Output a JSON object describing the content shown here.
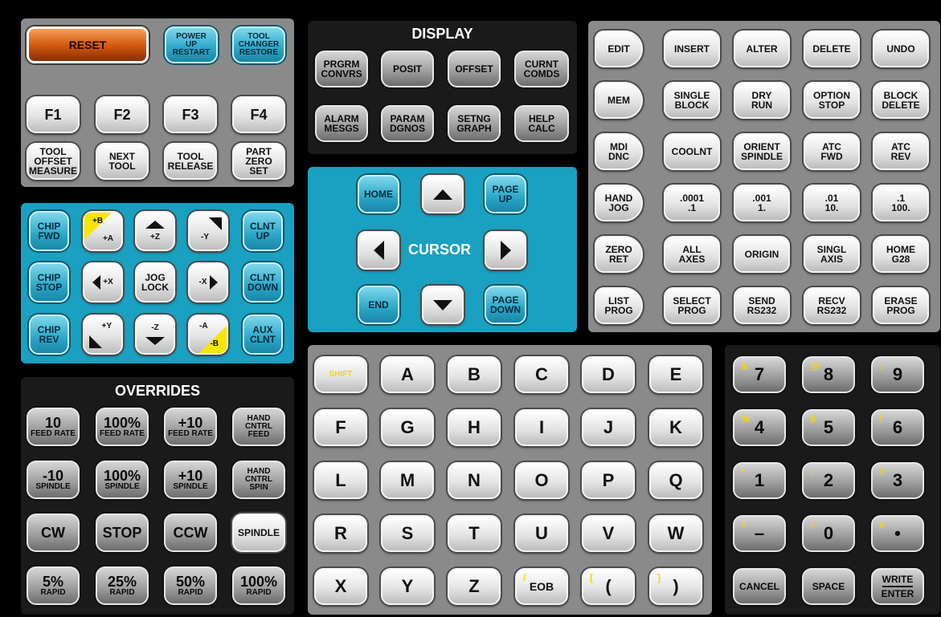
{
  "colors": {
    "grey_panel": "#8a8a8a",
    "dark_panel": "#1a1a1a",
    "teal_panel": "#1aa0c0",
    "reset": "#d45a10",
    "shift_text": "#f6d600"
  },
  "top_left": {
    "reset": "RESET",
    "power_up": [
      "POWER",
      "UP",
      "RESTART"
    ],
    "tool_changer": [
      "TOOL",
      "CHANGER",
      "RESTORE"
    ],
    "f_keys": [
      "F1",
      "F2",
      "F3",
      "F4"
    ],
    "tool_offset": [
      "TOOL",
      "OFFSET",
      "MEASURE"
    ],
    "next_tool": [
      "NEXT",
      "TOOL"
    ],
    "tool_release": [
      "TOOL",
      "RELEASE"
    ],
    "part_zero": [
      "PART",
      "ZERO",
      "SET"
    ]
  },
  "display": {
    "title": "DISPLAY",
    "keys": [
      [
        "PRGRM",
        "CONVRS"
      ],
      [
        "POSIT"
      ],
      [
        "OFFSET"
      ],
      [
        "CURNT",
        "COMDS"
      ],
      [
        "ALARM",
        "MESGS"
      ],
      [
        "PARAM",
        "DGNOS"
      ],
      [
        "SETNG",
        "GRAPH"
      ],
      [
        "HELP",
        "CALC"
      ]
    ]
  },
  "cursor": {
    "label": "CURSOR",
    "home": "HOME",
    "end": "END",
    "page_up": [
      "PAGE",
      "UP"
    ],
    "page_down": [
      "PAGE",
      "DOWN"
    ]
  },
  "modes": {
    "side": [
      [
        "EDIT"
      ],
      [
        "MEM"
      ],
      [
        "MDI",
        "DNC"
      ],
      [
        "HAND",
        "JOG"
      ],
      [
        "ZERO",
        "RET"
      ],
      [
        "LIST",
        "PROG"
      ]
    ],
    "rows": [
      [
        [
          "INSERT"
        ],
        [
          "ALTER"
        ],
        [
          "DELETE"
        ],
        [
          "UNDO"
        ]
      ],
      [
        [
          "SINGLE",
          "BLOCK"
        ],
        [
          "DRY",
          "RUN"
        ],
        [
          "OPTION",
          "STOP"
        ],
        [
          "BLOCK",
          "DELETE"
        ]
      ],
      [
        [
          "COOLNT"
        ],
        [
          "ORIENT",
          "SPINDLE"
        ],
        [
          "ATC",
          "FWD"
        ],
        [
          "ATC",
          "REV"
        ]
      ],
      [
        [
          ".0001",
          ".1"
        ],
        [
          ".001",
          "1."
        ],
        [
          ".01",
          "10."
        ],
        [
          ".1",
          "100."
        ]
      ],
      [
        [
          "ALL",
          "AXES"
        ],
        [
          "ORIGIN"
        ],
        [
          "SINGL",
          "AXIS"
        ],
        [
          "HOME",
          "G28"
        ]
      ],
      [
        [
          "SELECT",
          "PROG"
        ],
        [
          "SEND",
          "RS232"
        ],
        [
          "RECV",
          "RS232"
        ],
        [
          "ERASE",
          "PROG"
        ]
      ]
    ]
  },
  "jog": {
    "chip_fwd": [
      "CHIP",
      "FWD"
    ],
    "chip_stop": [
      "CHIP",
      "STOP"
    ],
    "chip_rev": [
      "CHIP",
      "REV"
    ],
    "clnt_up": [
      "CLNT",
      "UP"
    ],
    "clnt_down": [
      "CLNT",
      "DOWN"
    ],
    "aux_clnt": [
      "AUX",
      "CLNT"
    ],
    "plus_b": "+B",
    "plus_a": "+A",
    "plus_z": "+Z",
    "minus_y": "-Y",
    "plus_x": "+X",
    "jog_lock": [
      "JOG",
      "LOCK"
    ],
    "minus_x": "-X",
    "plus_y": "+Y",
    "minus_z": "-Z",
    "minus_a": "-A",
    "minus_b": "-B"
  },
  "overrides": {
    "title": "OVERRIDES",
    "rows": [
      [
        [
          "10",
          "FEED RATE"
        ],
        [
          "100%",
          "FEED RATE"
        ],
        [
          "+10",
          "FEED RATE"
        ],
        [
          "HAND",
          "CNTRL",
          "FEED"
        ]
      ],
      [
        [
          "-10",
          "SPINDLE"
        ],
        [
          "100%",
          "SPINDLE"
        ],
        [
          "+10",
          "SPINDLE"
        ],
        [
          "HAND",
          "CNTRL",
          "SPIN"
        ]
      ],
      [
        [
          "CW"
        ],
        [
          "STOP"
        ],
        [
          "CCW"
        ],
        [
          "SPINDLE"
        ]
      ],
      [
        [
          "5%",
          "RAPID"
        ],
        [
          "25%",
          "RAPID"
        ],
        [
          "50%",
          "RAPID"
        ],
        [
          "100%",
          "RAPID"
        ]
      ]
    ]
  },
  "alpha": {
    "rows": [
      [
        "SHIFT",
        "A",
        "B",
        "C",
        "D",
        "E"
      ],
      [
        "F",
        "G",
        "H",
        "I",
        "J",
        "K"
      ],
      [
        "L",
        "M",
        "N",
        "O",
        "P",
        "Q"
      ],
      [
        "R",
        "S",
        "T",
        "U",
        "V",
        "W"
      ],
      [
        "X",
        "Y",
        "Z",
        "EOB",
        "(",
        ")"
      ]
    ],
    "eob_corner": "/",
    "paren_open_corner": "[",
    "paren_close_corner": "]"
  },
  "numeric": {
    "rows": [
      [
        [
          "7",
          "&"
        ],
        [
          "8",
          "@"
        ],
        [
          "9",
          ":"
        ]
      ],
      [
        [
          "4",
          "%"
        ],
        [
          "5",
          "$"
        ],
        [
          "6",
          "!"
        ]
      ],
      [
        [
          "1",
          "*"
        ],
        [
          "2",
          ","
        ],
        [
          "3",
          "?"
        ]
      ],
      [
        [
          "–",
          "+"
        ],
        [
          "0",
          "="
        ],
        [
          "•",
          "#"
        ]
      ]
    ],
    "cancel": "CANCEL",
    "space": "SPACE",
    "write": "WRITE",
    "enter": "ENTER"
  }
}
